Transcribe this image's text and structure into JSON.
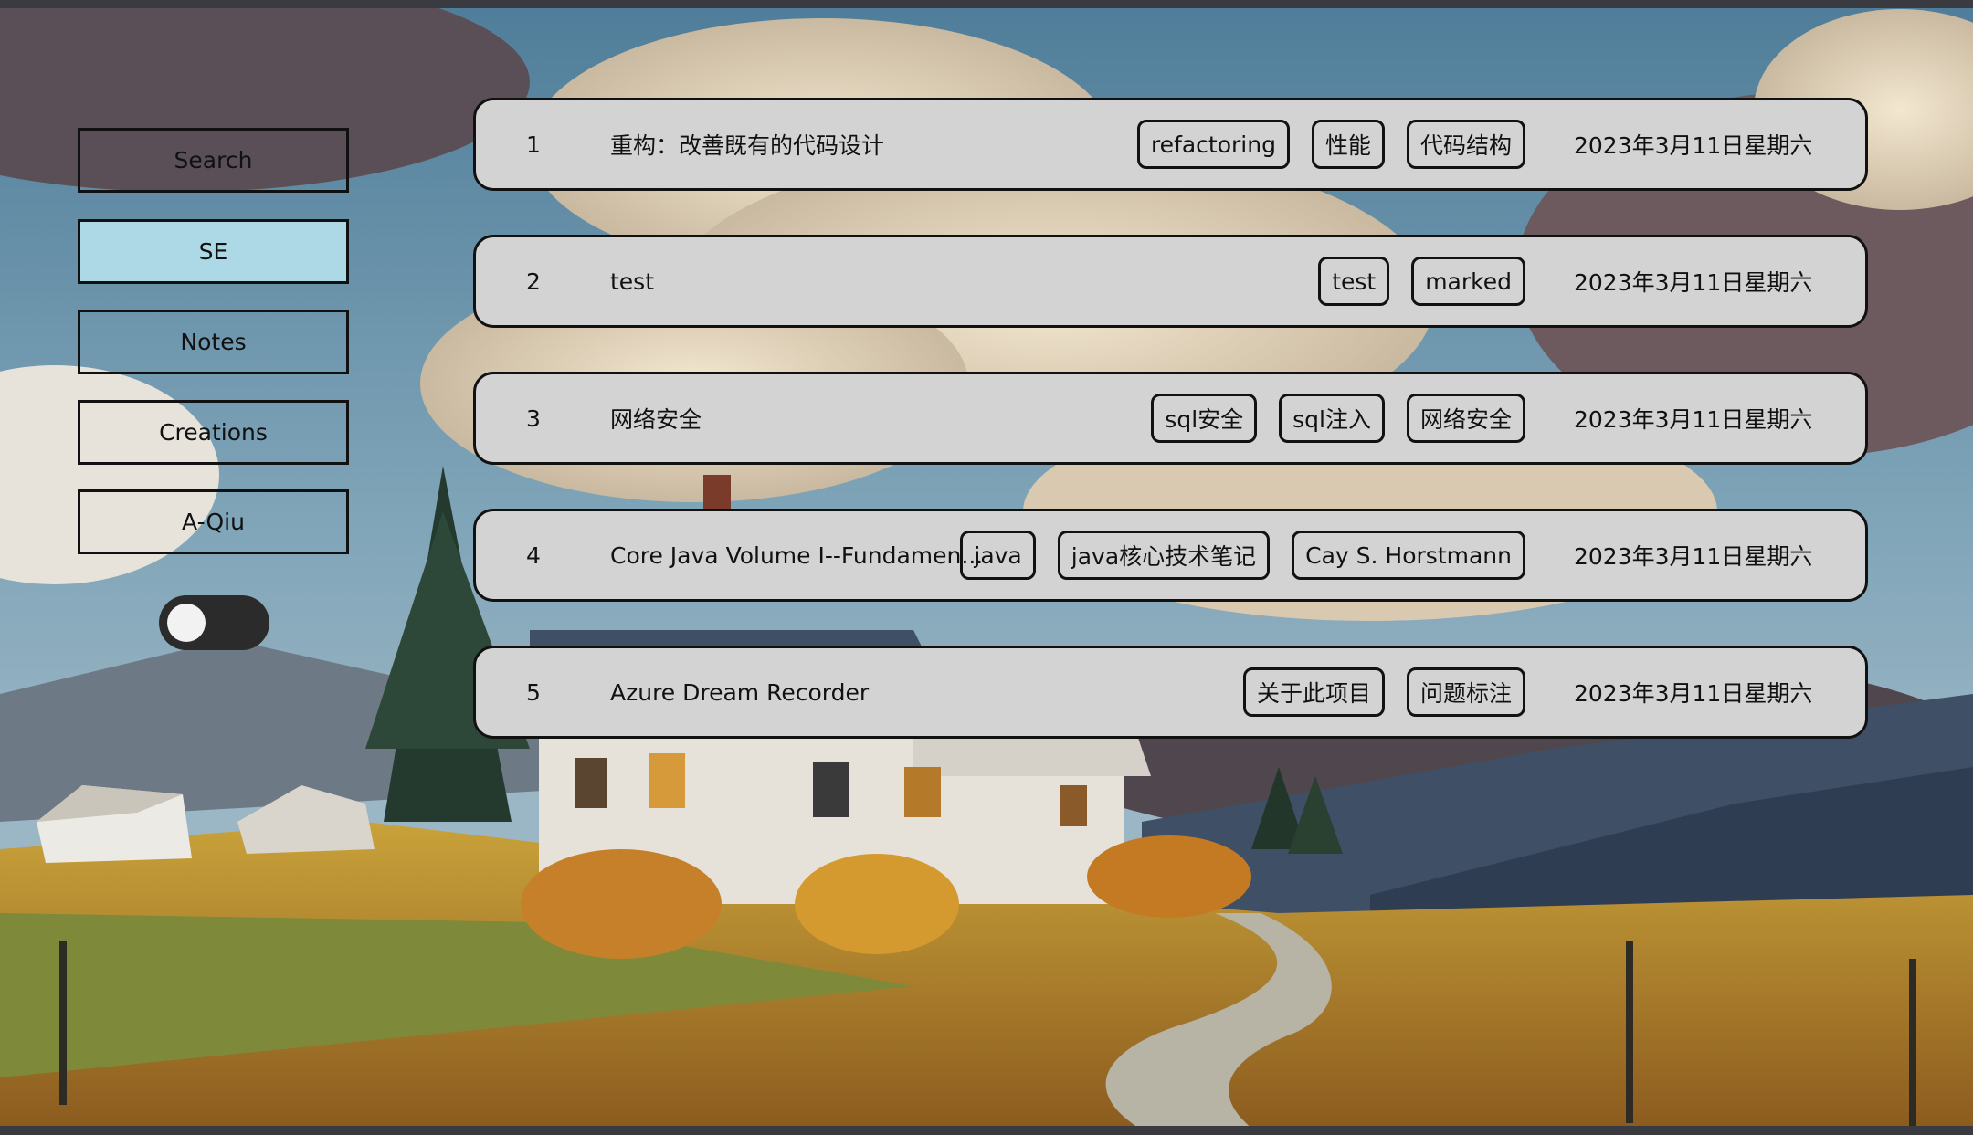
{
  "nav": {
    "items": [
      {
        "label": "Search",
        "active": false
      },
      {
        "label": "SE",
        "active": true
      },
      {
        "label": "Notes",
        "active": false
      },
      {
        "label": "Creations",
        "active": false
      },
      {
        "label": "A-Qiu",
        "active": false
      }
    ],
    "active_color": "#add8e6"
  },
  "toggle": {
    "state": "off"
  },
  "articles": [
    {
      "index": "1",
      "title": "重构：改善既有的代码设计",
      "tags": [
        "refactoring",
        "性能",
        "代码结构"
      ],
      "date": "2023年3月11日星期六"
    },
    {
      "index": "2",
      "title": "test",
      "tags": [
        "test",
        "marked"
      ],
      "date": "2023年3月11日星期六"
    },
    {
      "index": "3",
      "title": "网络安全",
      "tags": [
        "sql安全",
        "sql注入",
        "网络安全"
      ],
      "date": "2023年3月11日星期六"
    },
    {
      "index": "4",
      "title": "Core Java Volume I--Fundamen...",
      "tags": [
        "java",
        "java核心技术笔记",
        "Cay S. Horstmann"
      ],
      "date": "2023年3月11日星期六"
    },
    {
      "index": "5",
      "title": "Azure Dream Recorder",
      "tags": [
        "关于此项目",
        "问题标注"
      ],
      "date": "2023年3月11日星期六"
    }
  ],
  "colors": {
    "row_background": "#d3d3d3",
    "border": "#111111"
  }
}
